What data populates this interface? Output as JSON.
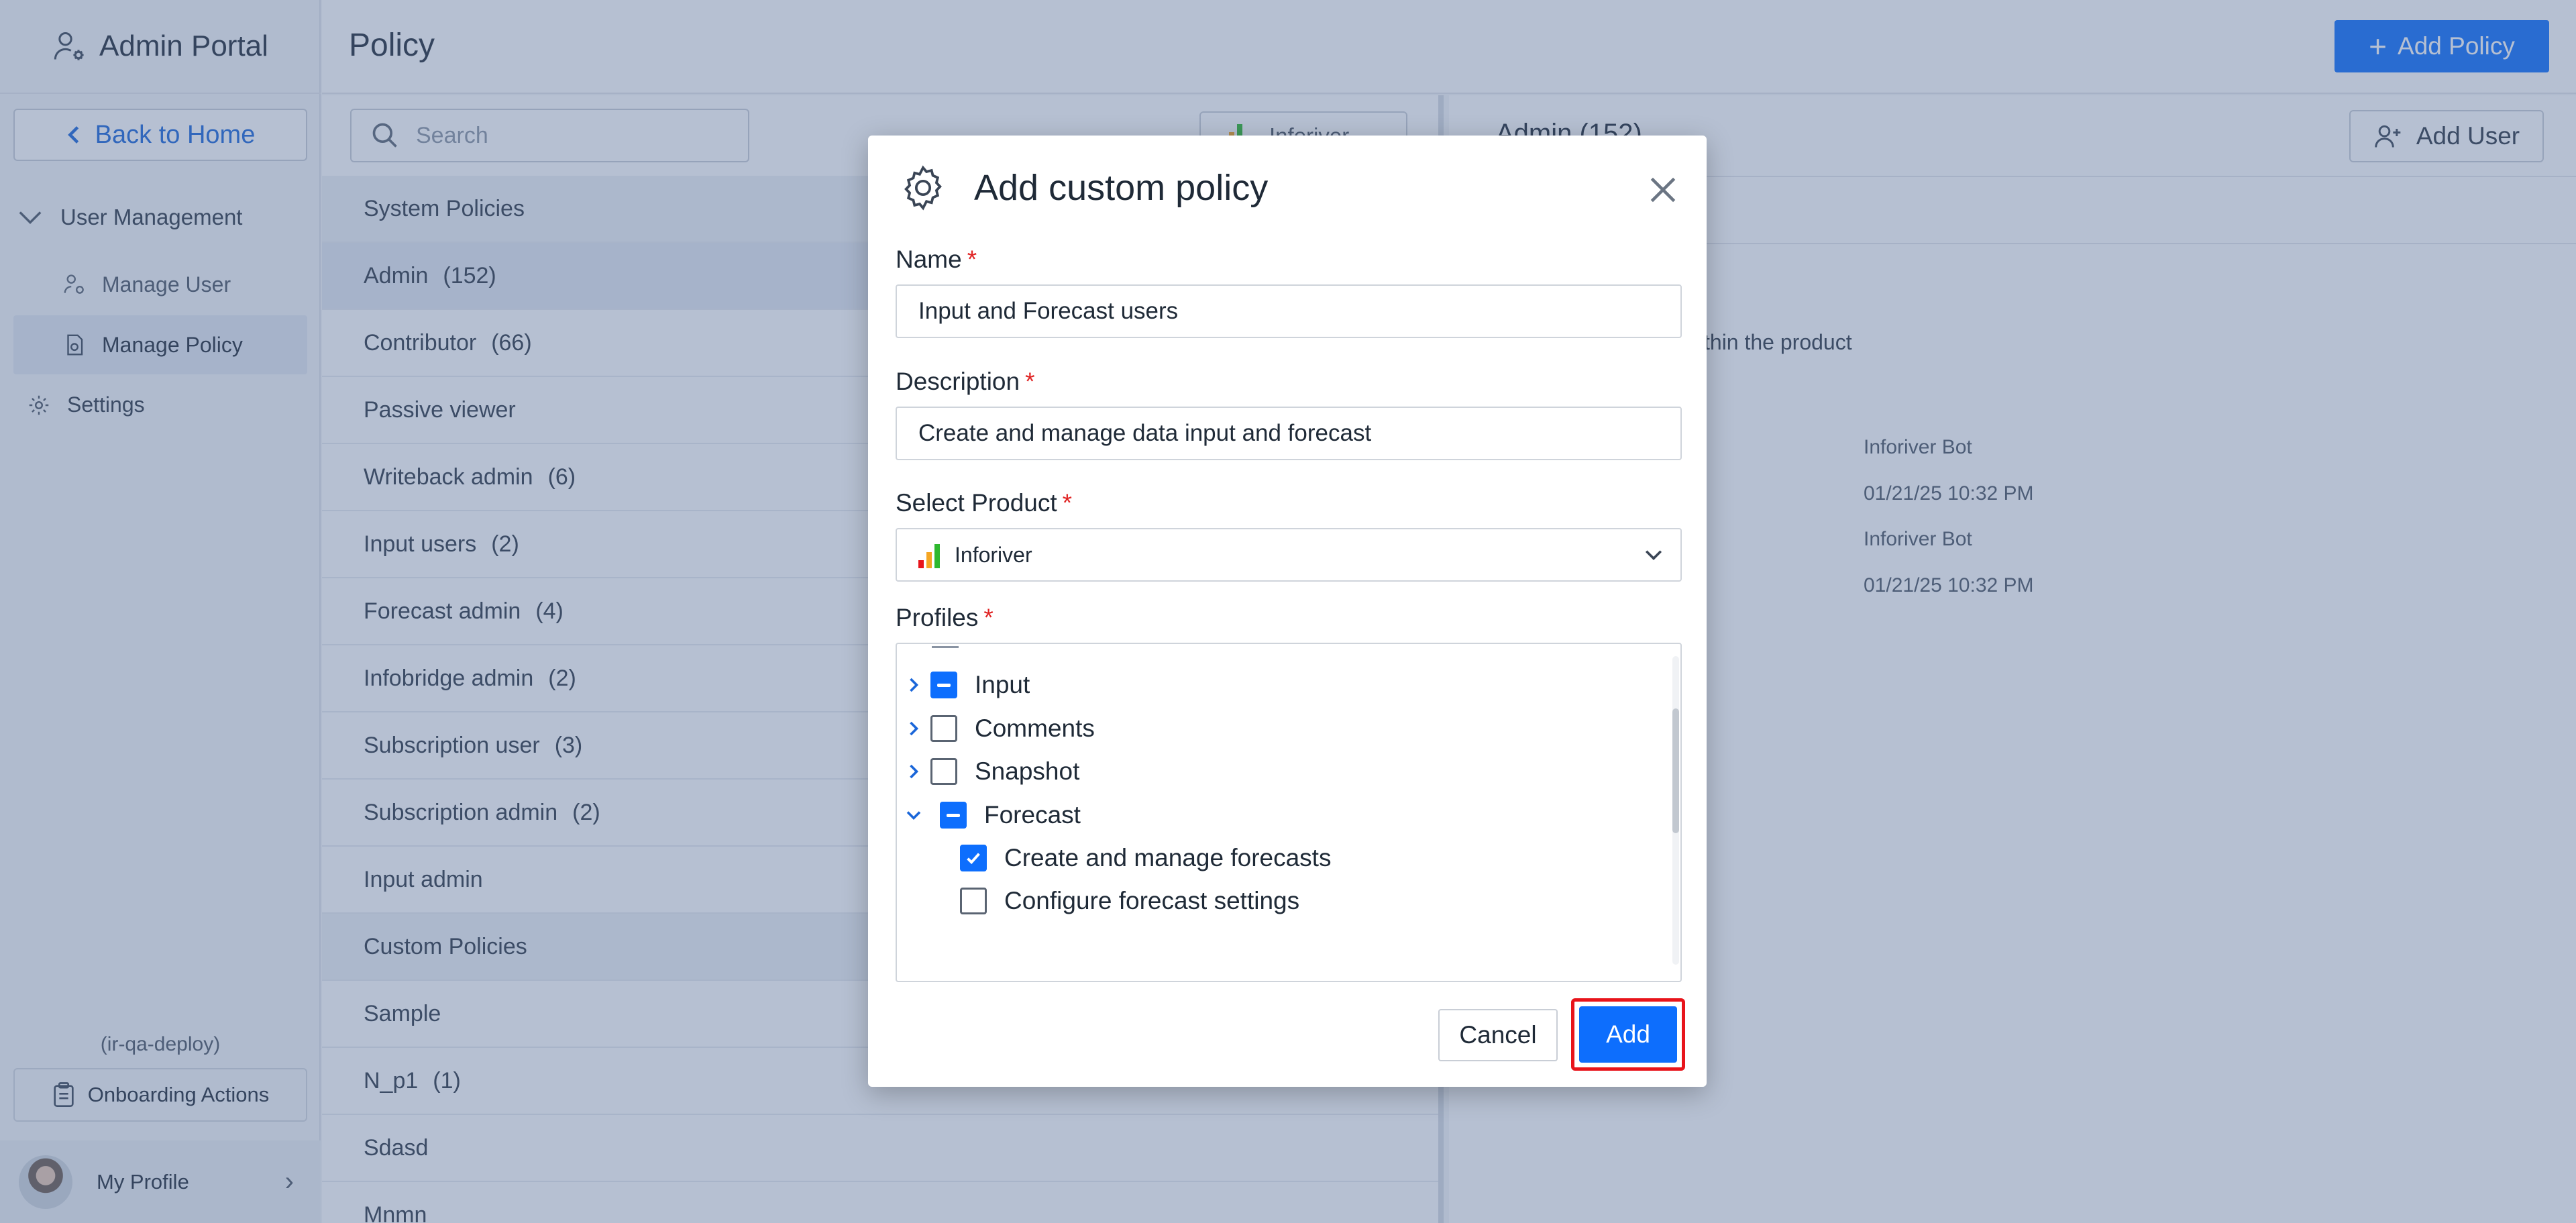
{
  "app": {
    "brand": "Admin Portal",
    "back_label": "Back to Home",
    "nav_group": "User Management",
    "nav_items": [
      "Manage User",
      "Manage Policy"
    ],
    "settings": "Settings",
    "deploy": "(ir-qa-deploy)",
    "onboarding": "Onboarding Actions",
    "profile": "My Profile"
  },
  "topbar": {
    "title": "Policy",
    "add_policy": "Add Policy"
  },
  "list": {
    "search_placeholder": "Search",
    "filter_label": "Inforiver",
    "rows": [
      {
        "name": "System Policies",
        "count": ""
      },
      {
        "name": "Admin",
        "count": "(152)"
      },
      {
        "name": "Contributor",
        "count": "(66)"
      },
      {
        "name": "Passive viewer",
        "count": ""
      },
      {
        "name": "Writeback admin",
        "count": "(6)"
      },
      {
        "name": "Input users",
        "count": "(2)"
      },
      {
        "name": "Forecast admin",
        "count": "(4)"
      },
      {
        "name": "Infobridge admin",
        "count": "(2)"
      },
      {
        "name": "Subscription user",
        "count": "(3)"
      },
      {
        "name": "Subscription admin",
        "count": "(2)"
      },
      {
        "name": "Input admin",
        "count": ""
      },
      {
        "name": "Custom Policies",
        "count": ""
      },
      {
        "name": "Sample",
        "count": ""
      },
      {
        "name": "N_p1",
        "count": "(1)"
      },
      {
        "name": "Sdasd",
        "count": ""
      },
      {
        "name": "Mnmn",
        "count": ""
      }
    ]
  },
  "detail": {
    "title": "Admin  (152)",
    "add_user": "Add User",
    "desc_fragment": "thin the product",
    "created_by": "Inforiver Bot",
    "created_at": "01/21/25 10:32 PM",
    "modified_by": "Inforiver Bot",
    "modified_at": "01/21/25 10:32 PM"
  },
  "modal": {
    "title": "Add custom policy",
    "name_label": "Name",
    "name_value": "Input and Forecast users",
    "description_label": "Description",
    "description_value": "Create and manage data input and forecast",
    "product_label": "Select Product",
    "product_value": "Inforiver",
    "profiles_label": "Profiles",
    "profiles": [
      {
        "label": "Input",
        "state": "indeterminate",
        "expanded": false
      },
      {
        "label": "Comments",
        "state": "unchecked",
        "expanded": false
      },
      {
        "label": "Snapshot",
        "state": "unchecked",
        "expanded": false
      },
      {
        "label": "Forecast",
        "state": "indeterminate",
        "expanded": true
      },
      {
        "label": "Create and manage forecasts",
        "state": "checked",
        "child": true
      },
      {
        "label": "Configure forecast settings",
        "state": "unchecked",
        "child": true
      }
    ],
    "cancel": "Cancel",
    "add": "Add"
  },
  "colors": {
    "primary": "#0d6efd",
    "highlight": "#e8141b",
    "required": "#e02424"
  }
}
